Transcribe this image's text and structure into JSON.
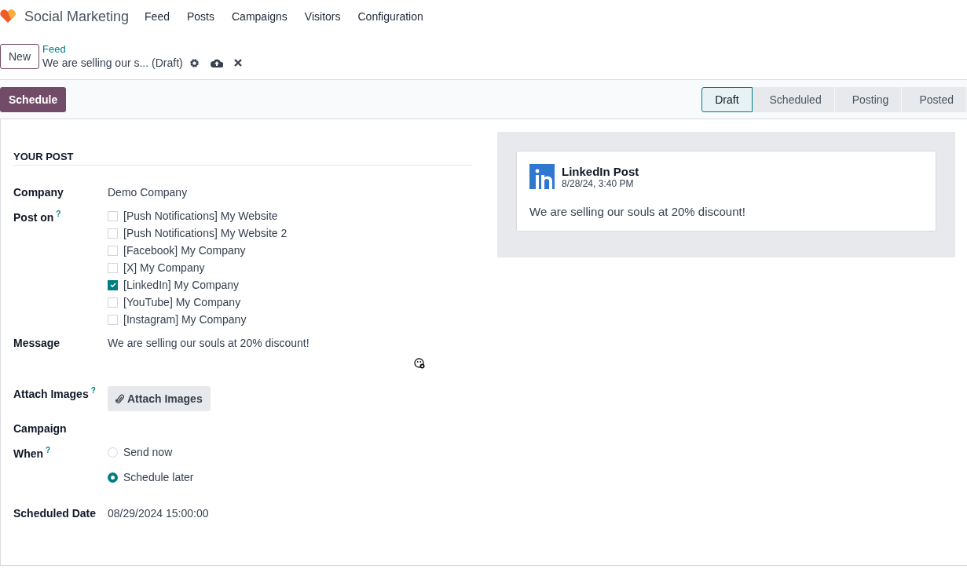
{
  "app": {
    "name": "Social Marketing"
  },
  "menu": [
    "Feed",
    "Posts",
    "Campaigns",
    "Visitors",
    "Configuration"
  ],
  "new_button": "New",
  "breadcrumb": {
    "parent": "Feed",
    "current": "We are selling our s... (Draft)"
  },
  "schedule_button": "Schedule",
  "stages": [
    {
      "label": "Draft",
      "selected": true
    },
    {
      "label": "Scheduled",
      "selected": false
    },
    {
      "label": "Posting",
      "selected": false
    },
    {
      "label": "Posted",
      "selected": false
    }
  ],
  "section_title": "YOUR POST",
  "fields": [
    {
      "kind": "text",
      "label": "Company",
      "value": "Demo Company"
    },
    {
      "kind": "checkboxes",
      "label": "Post on",
      "help": "?",
      "options": [
        {
          "label": "[Push Notifications] My Website",
          "checked": false
        },
        {
          "label": "[Push Notifications] My Website 2",
          "checked": false
        },
        {
          "label": "[Facebook] My Company",
          "checked": false
        },
        {
          "label": "[X] My Company",
          "checked": false
        },
        {
          "label": "[LinkedIn] My Company",
          "checked": true
        },
        {
          "label": "[YouTube] My Company",
          "checked": false
        },
        {
          "label": "[Instagram] My Company",
          "checked": false
        }
      ]
    },
    {
      "kind": "message",
      "label": "Message",
      "value": "We are selling our souls at 20% discount!"
    },
    {
      "kind": "button",
      "label": "Attach Images",
      "help": "?",
      "button": "Attach Images"
    },
    {
      "kind": "empty",
      "label": "Campaign"
    },
    {
      "kind": "radios",
      "label": "When",
      "help": "?",
      "options": [
        {
          "label": "Send now",
          "selected": false
        },
        {
          "label": "Schedule later",
          "selected": true
        }
      ]
    },
    {
      "kind": "text",
      "label": "Scheduled Date",
      "value": "08/29/2024 15:00:00"
    }
  ],
  "preview": {
    "title": "LinkedIn Post",
    "date": "8/28/24, 3:40 PM",
    "message": "We are selling our souls at 20% discount!"
  }
}
